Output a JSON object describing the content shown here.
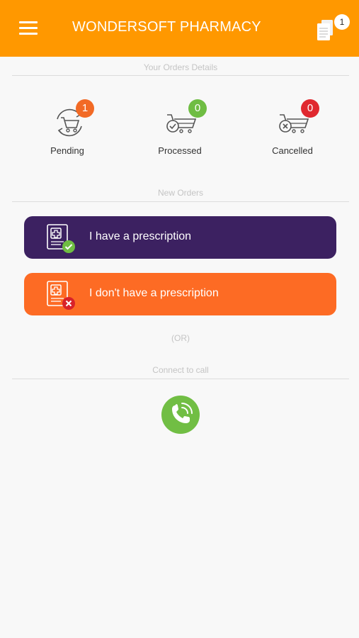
{
  "header": {
    "title": "WONDERSOFT PHARMACY",
    "menu_icon": "hamburger-menu-icon",
    "orders_icon": "document-icon",
    "orders_badge": "1",
    "background_color": "#ff9800"
  },
  "orders_summary": {
    "heading": "Your Orders Details",
    "items": [
      {
        "label": "Pending",
        "count": "1",
        "color": "#f26a25",
        "icon": "cart-refresh-icon"
      },
      {
        "label": "Processed",
        "count": "0",
        "color": "#6fbd43",
        "icon": "cart-check-icon"
      },
      {
        "label": "Cancelled",
        "count": "0",
        "color": "#e0282f",
        "icon": "cart-cancel-icon"
      }
    ]
  },
  "new_orders": {
    "heading": "New Orders",
    "buttons": [
      {
        "label": "I have a prescription",
        "color": "#3c2161",
        "icon": "prescription-check-icon"
      },
      {
        "label": "I don't have a prescription",
        "color": "#fd6b24",
        "icon": "prescription-cancel-icon"
      }
    ],
    "separator": "(OR)"
  },
  "call": {
    "heading": "Connect to call",
    "icon": "phone-icon",
    "color": "#71be44"
  }
}
